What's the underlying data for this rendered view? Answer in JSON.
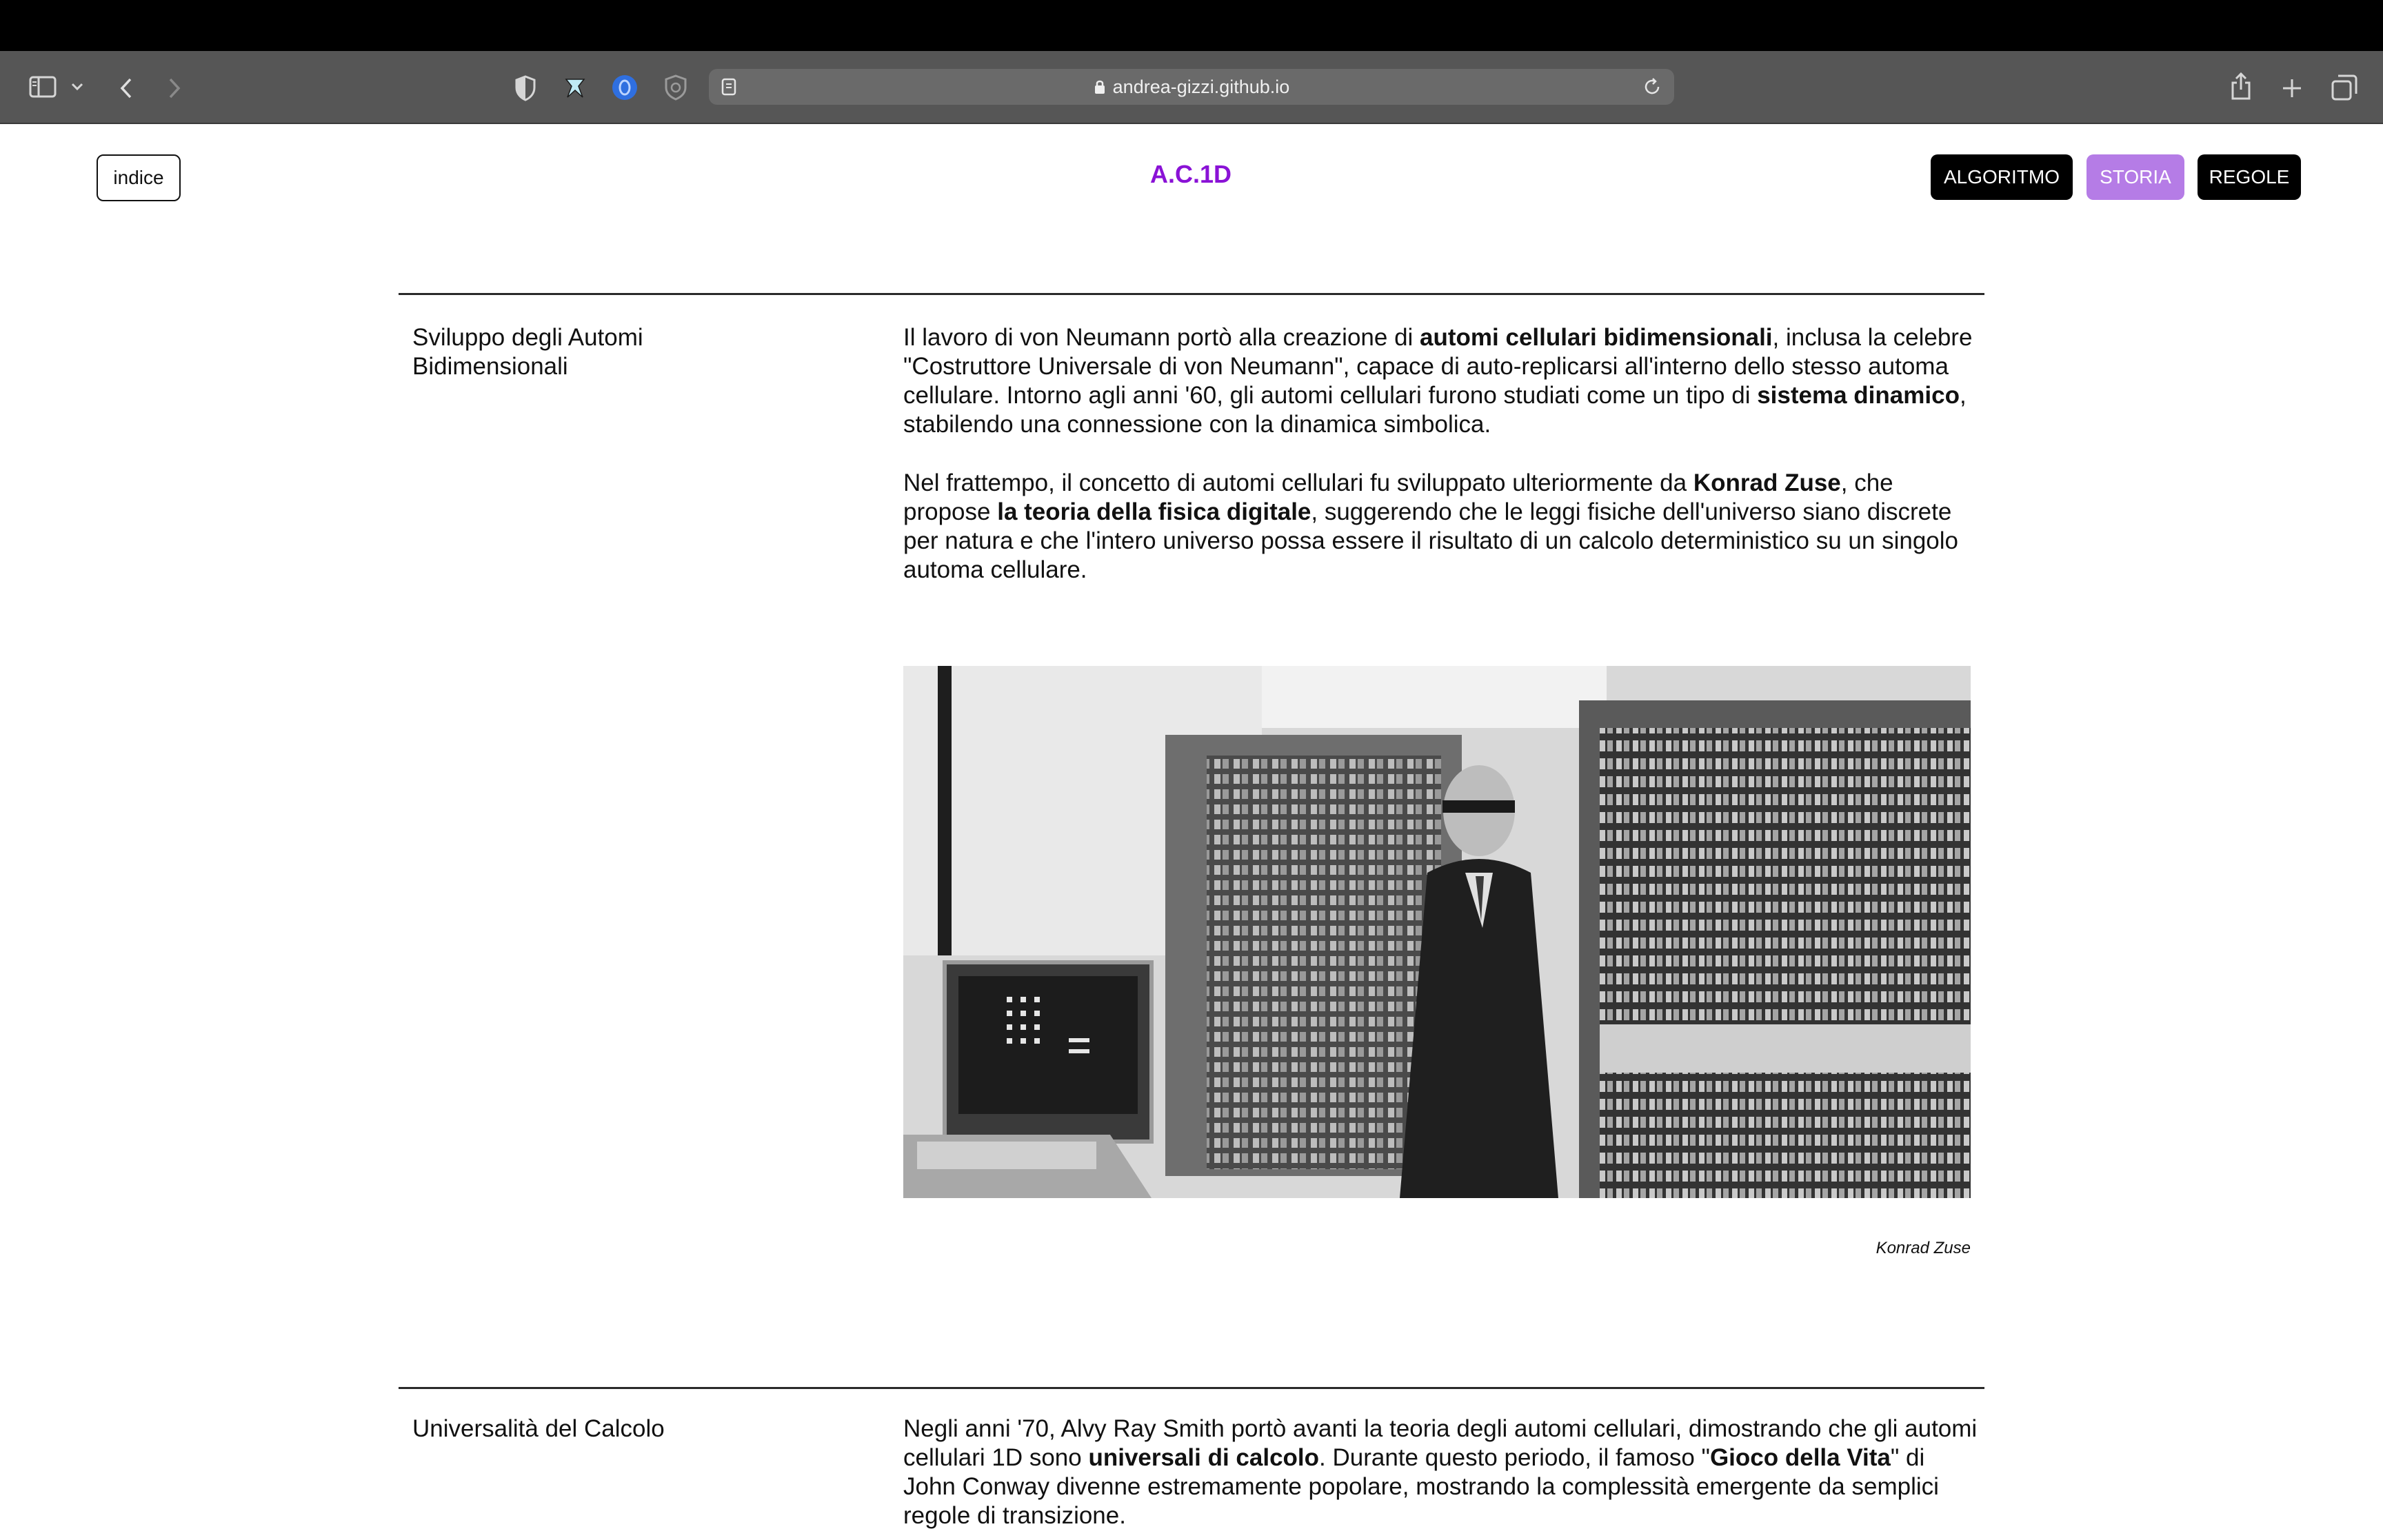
{
  "browser": {
    "url": "andrea-gizzi.github.io",
    "icons": [
      "sidebar-icon",
      "chevron-down-icon",
      "back-icon",
      "forward-icon",
      "shield-icon",
      "extension-icon",
      "extension-blue-icon",
      "privacy-shield-icon",
      "reader-icon",
      "lock-icon",
      "reload-icon",
      "share-icon",
      "new-tab-icon",
      "tabs-overview-icon"
    ]
  },
  "header": {
    "index_label": "indice",
    "brand": "A.C.1D",
    "brand_color": "#8a12d6",
    "nav": [
      {
        "label": "ALGORITMO",
        "active": false
      },
      {
        "label": "STORIA",
        "active": true,
        "color": "#b57ce6"
      },
      {
        "label": "REGOLE",
        "active": false
      }
    ]
  },
  "sections": [
    {
      "title": "Sviluppo degli Automi Bidimensionali",
      "paragraphs": [
        {
          "parts": [
            {
              "text": "Il lavoro di von Neumann portò alla creazione di ",
              "bold": false
            },
            {
              "text": "automi cellulari bidimensionali",
              "bold": true
            },
            {
              "text": ", inclusa la celebre \"Costruttore Universale di von Neumann\", capace di auto-replicarsi all'interno dello stesso automa cellulare. Intorno agli anni '60, gli automi cellulari furono studiati come un tipo di ",
              "bold": false
            },
            {
              "text": "sistema dinamico",
              "bold": true
            },
            {
              "text": ", stabilendo una connessione con la dinamica simbolica.",
              "bold": false
            }
          ]
        },
        {
          "parts": [
            {
              "text": "Nel frattempo, il concetto di automi cellulari fu sviluppato ulteriormente da ",
              "bold": false
            },
            {
              "text": "Konrad Zuse",
              "bold": true
            },
            {
              "text": ", che propose ",
              "bold": false
            },
            {
              "text": "la teoria della fisica digitale",
              "bold": true
            },
            {
              "text": ", suggerendo che le leggi fisiche dell'universo siano discrete per natura e che l'intero universo possa essere il risultato di un calcolo deterministico su un singolo automa cellulare.",
              "bold": false
            }
          ]
        }
      ],
      "image_caption": "Konrad Zuse"
    },
    {
      "title": "Universalità del Calcolo",
      "paragraphs": [
        {
          "parts": [
            {
              "text": "Negli anni '70, Alvy Ray Smith portò avanti la teoria degli automi cellulari, dimostrando che gli automi cellulari 1D sono ",
              "bold": false
            },
            {
              "text": "universali di calcolo",
              "bold": true
            },
            {
              "text": ". Durante questo periodo, il famoso \"",
              "bold": false
            },
            {
              "text": "Gioco della Vita",
              "bold": true
            },
            {
              "text": "\" di John Conway divenne estremamente popolare, mostrando la complessità emergente da semplici regole di transizione.",
              "bold": false
            }
          ]
        }
      ]
    }
  ]
}
